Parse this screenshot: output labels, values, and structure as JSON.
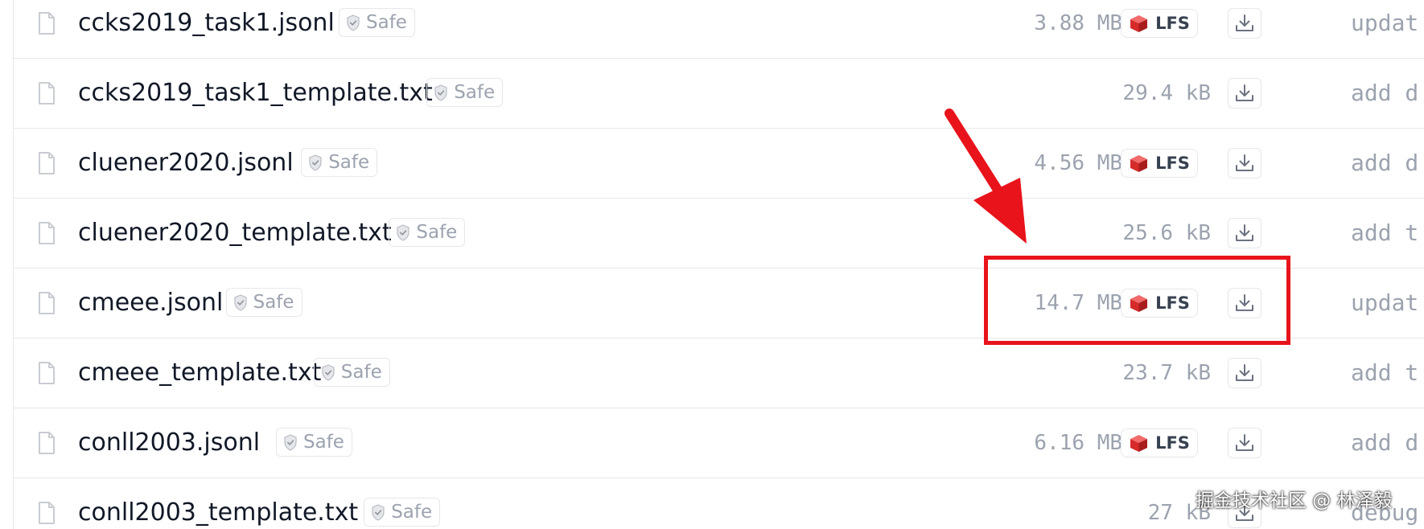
{
  "file_list": {
    "rows": [
      {
        "name": "ccks2019_task1.jsonl",
        "badge": "Safe",
        "size": "3.88 MB",
        "lfs": "LFS",
        "commit": "updat"
      },
      {
        "name": "ccks2019_task1_template.txt",
        "badge": "Safe",
        "size": "29.4 kB",
        "lfs": null,
        "commit": "add d"
      },
      {
        "name": "cluener2020.jsonl",
        "badge": "Safe",
        "size": "4.56 MB",
        "lfs": "LFS",
        "commit": "add d"
      },
      {
        "name": "cluener2020_template.txt",
        "badge": "Safe",
        "size": "25.6 kB",
        "lfs": null,
        "commit": "add t"
      },
      {
        "name": "cmeee.jsonl",
        "badge": "Safe",
        "size": "14.7 MB",
        "lfs": "LFS",
        "commit": "updat"
      },
      {
        "name": "cmeee_template.txt",
        "badge": "Safe",
        "size": "23.7 kB",
        "lfs": null,
        "commit": "add t"
      },
      {
        "name": "conll2003.jsonl",
        "badge": "Safe",
        "size": "6.16 MB",
        "lfs": "LFS",
        "commit": "add d"
      },
      {
        "name": "conll2003_template.txt",
        "badge": "Safe",
        "size": "27 kB",
        "lfs": null,
        "commit": "debug"
      }
    ]
  },
  "icons": {
    "file": "file-icon",
    "shield": "shield-check-icon",
    "lfs": "lfs-cube-icon",
    "download": "download-icon"
  },
  "annotation": {
    "highlight_row": 4,
    "color": "#e8131b"
  },
  "watermark": "掘金技术社区 @ 林泽毅",
  "colors": {
    "text": "#111827",
    "muted": "#9ca3af",
    "border": "#e5e7eb",
    "lfs_red": "#e5383b"
  }
}
